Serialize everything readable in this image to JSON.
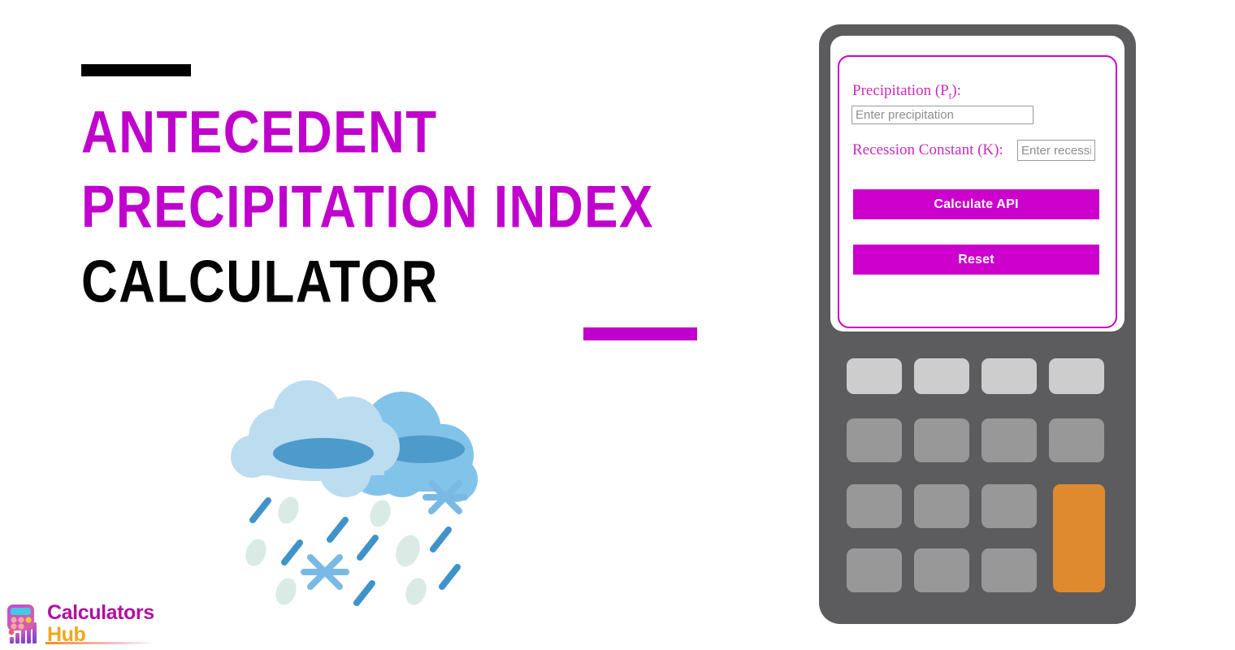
{
  "page": {
    "background_color": "#ffffff",
    "accent_purple": "#c000cc",
    "accent_orange": "#de8b30",
    "device_gray": "#5c5c5e"
  },
  "hero": {
    "rule_top_color": "#000000",
    "rule_bottom_color": "#c000cc",
    "title_lines": [
      {
        "text": "Antecedent",
        "color": "#c000cc"
      },
      {
        "text": "Precipitation Index",
        "color": "#c000cc"
      },
      {
        "text": "Calculator",
        "color": "#050505"
      }
    ]
  },
  "illustration": {
    "name": "rain-and-snow-clouds",
    "cloud_light_color": "#bcdcf0",
    "cloud_mid_color": "#82c3ea",
    "cloud_shadow_color": "#4c9bcb",
    "rain_streak_color": "#3f93c9",
    "droplet_color": "#d9ebe4",
    "snowflake_color": "#79b9e4"
  },
  "logo": {
    "line1": "Calculators",
    "line2": "Hub",
    "line1_color": "#b0119e",
    "line2_color": "#f0a71c",
    "mark_name": "calculator-bar-chart-logo-icon"
  },
  "calculator_app": {
    "fields": [
      {
        "id": "precipitation",
        "label": "Precipitation (P",
        "label_sub": "t",
        "label_tail": "):",
        "placeholder": "Enter precipitation",
        "value": ""
      },
      {
        "id": "recession_constant",
        "label": "Recession Constant (K):",
        "placeholder": "Enter recession constant",
        "value": ""
      }
    ],
    "buttons": [
      {
        "id": "calculate",
        "label": "Calculate API",
        "color": "#cc00cc",
        "text_color": "#ffffff"
      },
      {
        "id": "reset",
        "label": "Reset",
        "color": "#cc00cc",
        "text_color": "#ffffff"
      }
    ]
  },
  "keypad": {
    "rows": 4,
    "cols": 4,
    "key_light_color": "#cdcdcd",
    "key_mid_color": "#989899",
    "key_accent_color": "#de8b30",
    "keys": [
      {
        "row": 1,
        "col": 1,
        "style": "light"
      },
      {
        "row": 1,
        "col": 2,
        "style": "light"
      },
      {
        "row": 1,
        "col": 3,
        "style": "light"
      },
      {
        "row": 1,
        "col": 4,
        "style": "light"
      },
      {
        "row": 2,
        "col": 1,
        "style": "mid"
      },
      {
        "row": 2,
        "col": 2,
        "style": "mid"
      },
      {
        "row": 2,
        "col": 3,
        "style": "mid"
      },
      {
        "row": 2,
        "col": 4,
        "style": "mid"
      },
      {
        "row": 3,
        "col": 1,
        "style": "mid"
      },
      {
        "row": 3,
        "col": 2,
        "style": "mid"
      },
      {
        "row": 3,
        "col": 3,
        "style": "mid"
      },
      {
        "row": 3,
        "col": 4,
        "style": "accent",
        "span_rows": 2
      },
      {
        "row": 4,
        "col": 1,
        "style": "mid"
      },
      {
        "row": 4,
        "col": 2,
        "style": "mid"
      },
      {
        "row": 4,
        "col": 3,
        "style": "mid"
      }
    ]
  }
}
